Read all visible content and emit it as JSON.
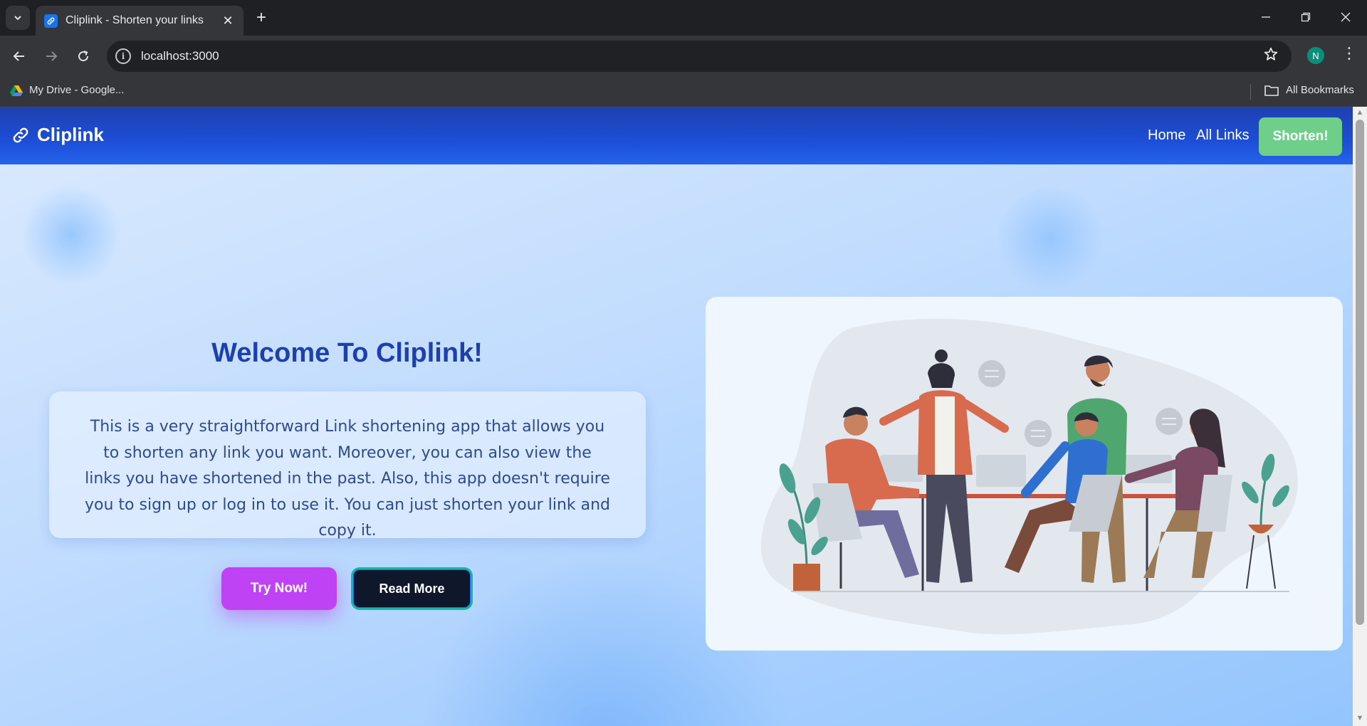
{
  "browser": {
    "tab_title": "Cliplink - Shorten your links",
    "url": "localhost:3000",
    "profile_initial": "N",
    "bookmarks": [
      {
        "label": "My Drive - Google..."
      }
    ],
    "all_bookmarks_label": "All Bookmarks"
  },
  "site": {
    "brand": "Cliplink",
    "nav": {
      "home": "Home",
      "all_links": "All Links",
      "shorten": "Shorten!"
    },
    "hero": {
      "title": "Welcome To Cliplink!",
      "description": "This is a very straightforward Link shortening app that allows you to shorten any link you want. Moreover, you can also view the links you have shortened in the past. Also, this app doesn't require you to sign up or log in to use it. You can just shorten your link and copy it.",
      "try_label": "Try Now!",
      "read_more_label": "Read More"
    }
  },
  "colors": {
    "nav_gradient_start": "#1e40af",
    "accent_green": "#6fcf8a",
    "try_button": "#c042f5",
    "read_more_button": "#0f172a",
    "title_blue": "#1e40af"
  }
}
